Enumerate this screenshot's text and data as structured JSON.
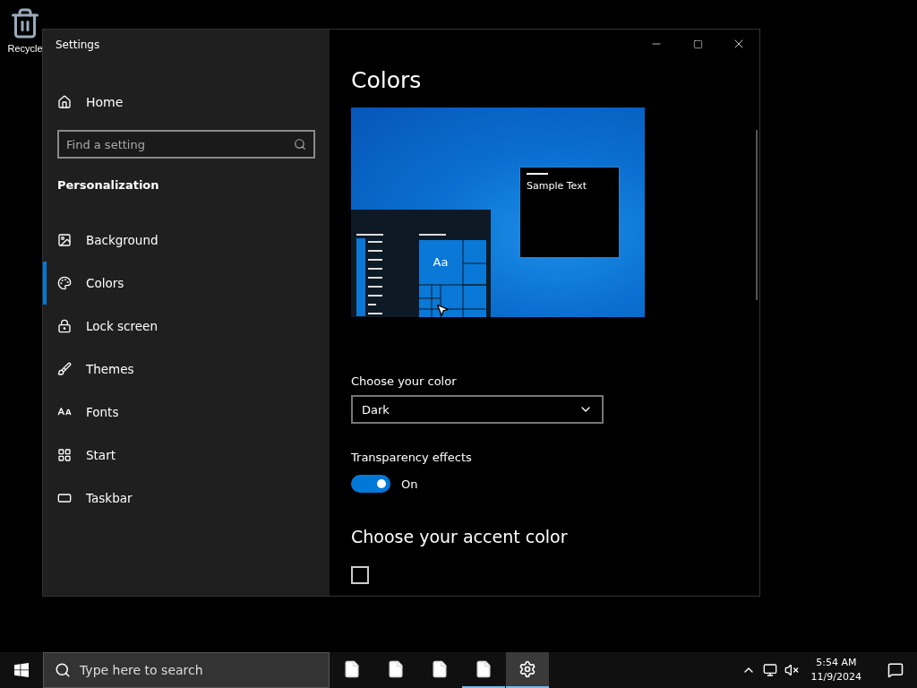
{
  "desktop_icons": [
    {
      "label": "Recycle"
    }
  ],
  "window": {
    "title": "Settings"
  },
  "sidebar": {
    "home": "Home",
    "search": {
      "placeholder": "Find a setting"
    },
    "section": "Personalization",
    "items": [
      {
        "label": "Background",
        "kind": "image",
        "selected": false
      },
      {
        "label": "Colors",
        "kind": "palette",
        "selected": true
      },
      {
        "label": "Lock screen",
        "kind": "lock",
        "selected": false
      },
      {
        "label": "Themes",
        "kind": "brush",
        "selected": false
      },
      {
        "label": "Fonts",
        "kind": "fonts",
        "selected": false
      },
      {
        "label": "Start",
        "kind": "start",
        "selected": false
      },
      {
        "label": "Taskbar",
        "kind": "taskbar",
        "selected": false
      }
    ]
  },
  "content": {
    "title": "Colors",
    "preview": {
      "sample_text": "Sample Text",
      "tile_text": "Aa"
    },
    "choose_color": {
      "label": "Choose your color",
      "value": "Dark"
    },
    "transparency": {
      "label": "Transparency effects",
      "on": true,
      "state_text": "On"
    },
    "accent_heading": "Choose your accent color",
    "accent_checkbox": {
      "checked": false
    }
  },
  "taskbar": {
    "search_placeholder": "Type here to search",
    "apps": [
      {
        "kind": "file",
        "running": false,
        "selected": false
      },
      {
        "kind": "file",
        "running": false,
        "selected": false
      },
      {
        "kind": "file",
        "running": false,
        "selected": false
      },
      {
        "kind": "file",
        "running": true,
        "selected": false
      },
      {
        "kind": "settings",
        "running": true,
        "selected": true
      }
    ],
    "time": "5:54 AM",
    "date": "11/9/2024"
  }
}
